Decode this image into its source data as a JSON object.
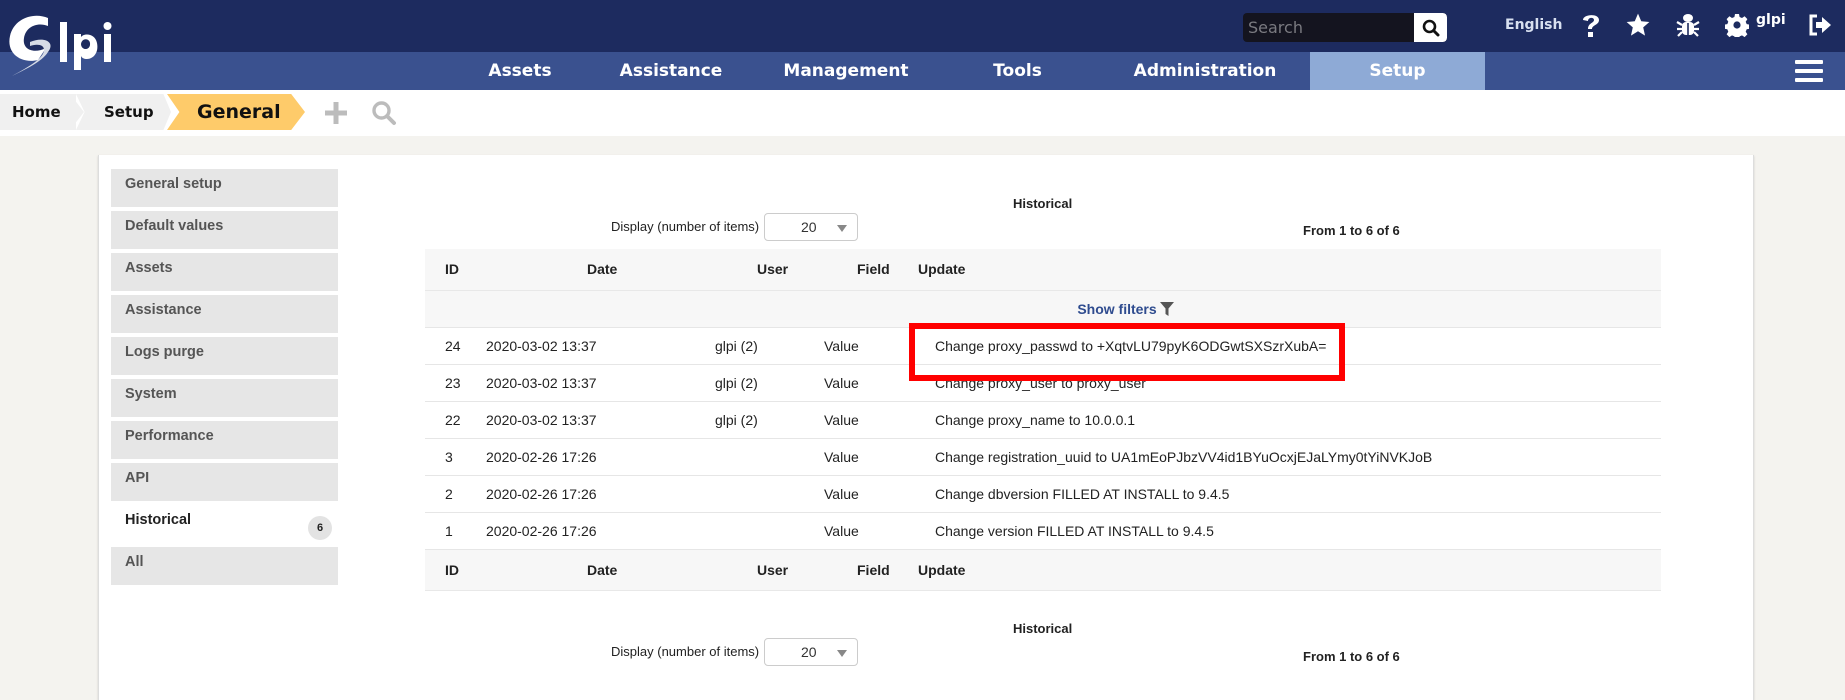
{
  "header": {
    "search_placeholder": "Search",
    "language": "English",
    "username": "glpi",
    "icons": [
      "search-icon",
      "help-icon",
      "star-icon",
      "bug-icon",
      "gear-icon",
      "logout-icon"
    ]
  },
  "menu": {
    "items": [
      {
        "label": "Assets"
      },
      {
        "label": "Assistance"
      },
      {
        "label": "Management"
      },
      {
        "label": "Tools"
      },
      {
        "label": "Administration"
      },
      {
        "label": "Setup",
        "active": true
      }
    ]
  },
  "breadcrumb": {
    "items": [
      "Home",
      "Setup",
      "General"
    ]
  },
  "sidebar": {
    "items": [
      {
        "label": "General setup"
      },
      {
        "label": "Default values"
      },
      {
        "label": "Assets"
      },
      {
        "label": "Assistance"
      },
      {
        "label": "Logs purge"
      },
      {
        "label": "System"
      },
      {
        "label": "Performance"
      },
      {
        "label": "API"
      },
      {
        "label": "Historical",
        "badge": "6",
        "active": true
      },
      {
        "label": "All"
      }
    ]
  },
  "historical": {
    "caption": "Historical",
    "display_label": "Display (number of items)",
    "display_value": "20",
    "count_text": "From 1 to 6 of 6",
    "show_filters": "Show filters",
    "columns": [
      "ID",
      "Date",
      "User",
      "Field",
      "Update"
    ],
    "rows": [
      {
        "id": "24",
        "date": "2020-03-02 13:37",
        "user": "glpi (2)",
        "field": "Value",
        "update": "Change proxy_passwd to +XqtvLU79pyK6ODGwtSXSzrXubA="
      },
      {
        "id": "23",
        "date": "2020-03-02 13:37",
        "user": "glpi (2)",
        "field": "Value",
        "update": "Change proxy_user to proxy_user"
      },
      {
        "id": "22",
        "date": "2020-03-02 13:37",
        "user": "glpi (2)",
        "field": "Value",
        "update": "Change proxy_name to 10.0.0.1"
      },
      {
        "id": "3",
        "date": "2020-02-26 17:26",
        "user": "",
        "field": "Value",
        "update": "Change registration_uuid to UA1mEoPJbzVV4id1BYuOcxjEJaLYmy0tYiNVKJoB"
      },
      {
        "id": "2",
        "date": "2020-02-26 17:26",
        "user": "",
        "field": "Value",
        "update": "Change dbversion FILLED AT INSTALL to 9.4.5"
      },
      {
        "id": "1",
        "date": "2020-02-26 17:26",
        "user": "",
        "field": "Value",
        "update": "Change version FILLED AT INSTALL to 9.4.5"
      }
    ]
  },
  "colors": {
    "topbar": "#1d2b5f",
    "navbar": "#3a518f",
    "active_menu": "#8eaad6",
    "breadcrumb_active": "#fecb6a",
    "highlight_box": "#ff0000",
    "link": "#2f4c8f"
  }
}
